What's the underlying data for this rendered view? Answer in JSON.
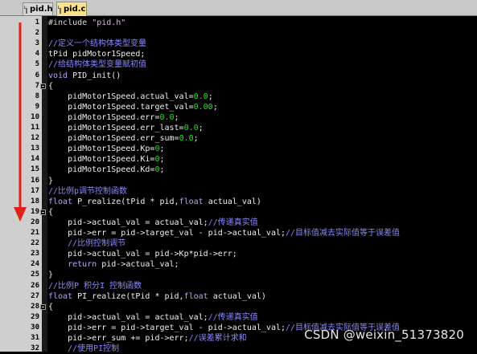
{
  "tabs": [
    {
      "label": "pid.h",
      "active": false
    },
    {
      "label": "pid.c",
      "active": true
    }
  ],
  "lines": [
    {
      "n": "1",
      "fold": false,
      "segs": [
        [
          "pre",
          "#include "
        ],
        [
          "str",
          "\"pid.h\""
        ]
      ]
    },
    {
      "n": "2",
      "fold": false,
      "segs": []
    },
    {
      "n": "3",
      "fold": false,
      "segs": [
        [
          "cmt",
          "//定义一个结构体类型变量"
        ]
      ]
    },
    {
      "n": "4",
      "fold": false,
      "segs": [
        [
          "id",
          "tPid pidMotor1Speed;"
        ]
      ]
    },
    {
      "n": "5",
      "fold": false,
      "segs": [
        [
          "cmt",
          "//给结构体类型变量赋初值"
        ]
      ]
    },
    {
      "n": "6",
      "fold": false,
      "segs": [
        [
          "kw",
          "void "
        ],
        [
          "id",
          "PID_init()"
        ]
      ]
    },
    {
      "n": "7",
      "fold": true,
      "segs": [
        [
          "op",
          "{"
        ]
      ]
    },
    {
      "n": "8",
      "fold": false,
      "segs": [
        [
          "id",
          "    pidMotor1Speed.actual_val="
        ],
        [
          "num",
          "0.0"
        ],
        [
          "op",
          ";"
        ]
      ]
    },
    {
      "n": "9",
      "fold": false,
      "segs": [
        [
          "id",
          "    pidMotor1Speed.target_val="
        ],
        [
          "num",
          "0.00"
        ],
        [
          "op",
          ";"
        ]
      ]
    },
    {
      "n": "10",
      "fold": false,
      "segs": [
        [
          "id",
          "    pidMotor1Speed.err="
        ],
        [
          "num",
          "0.0"
        ],
        [
          "op",
          ";"
        ]
      ]
    },
    {
      "n": "11",
      "fold": false,
      "segs": [
        [
          "id",
          "    pidMotor1Speed.err_last="
        ],
        [
          "num",
          "0.0"
        ],
        [
          "op",
          ";"
        ]
      ]
    },
    {
      "n": "12",
      "fold": false,
      "segs": [
        [
          "id",
          "    pidMotor1Speed.err_sum="
        ],
        [
          "num",
          "0.0"
        ],
        [
          "op",
          ";"
        ]
      ]
    },
    {
      "n": "13",
      "fold": false,
      "segs": [
        [
          "id",
          "    pidMotor1Speed.Kp="
        ],
        [
          "num",
          "0"
        ],
        [
          "op",
          ";"
        ]
      ]
    },
    {
      "n": "14",
      "fold": false,
      "segs": [
        [
          "id",
          "    pidMotor1Speed.Ki="
        ],
        [
          "num",
          "0"
        ],
        [
          "op",
          ";"
        ]
      ]
    },
    {
      "n": "15",
      "fold": false,
      "segs": [
        [
          "id",
          "    pidMotor1Speed.Kd="
        ],
        [
          "num",
          "0"
        ],
        [
          "op",
          ";"
        ]
      ]
    },
    {
      "n": "16",
      "fold": false,
      "segs": [
        [
          "op",
          "}"
        ]
      ]
    },
    {
      "n": "17",
      "fold": false,
      "segs": [
        [
          "cmt",
          "//比例p调节控制函数"
        ]
      ]
    },
    {
      "n": "18",
      "fold": false,
      "segs": [
        [
          "kw",
          "float "
        ],
        [
          "id",
          "P_realize(tPid * pid,"
        ],
        [
          "kw",
          "float "
        ],
        [
          "id",
          "actual_val)"
        ]
      ]
    },
    {
      "n": "19",
      "fold": true,
      "segs": [
        [
          "op",
          "{"
        ]
      ]
    },
    {
      "n": "20",
      "fold": false,
      "segs": [
        [
          "id",
          "    pid->actual_val = actual_val;"
        ],
        [
          "cmt",
          "//传递真实值"
        ]
      ]
    },
    {
      "n": "21",
      "fold": false,
      "segs": [
        [
          "id",
          "    pid->err = pid->target_val - pid->actual_val;"
        ],
        [
          "cmt",
          "//目标值减去实际值等于误差值"
        ]
      ]
    },
    {
      "n": "22",
      "fold": false,
      "segs": [
        [
          "cmt",
          "    //比例控制调节"
        ]
      ]
    },
    {
      "n": "23",
      "fold": false,
      "segs": [
        [
          "id",
          "    pid->actual_val = pid->Kp*pid->err;"
        ]
      ]
    },
    {
      "n": "24",
      "fold": false,
      "segs": [
        [
          "kw",
          "    return "
        ],
        [
          "id",
          "pid->actual_val;"
        ]
      ]
    },
    {
      "n": "25",
      "fold": false,
      "segs": [
        [
          "op",
          "}"
        ]
      ]
    },
    {
      "n": "26",
      "fold": false,
      "segs": [
        [
          "cmt",
          "//比例P 积分I 控制函数"
        ]
      ]
    },
    {
      "n": "27",
      "fold": false,
      "segs": [
        [
          "kw",
          "float "
        ],
        [
          "id",
          "PI_realize(tPid * pid,"
        ],
        [
          "kw",
          "float "
        ],
        [
          "id",
          "actual_val)"
        ]
      ]
    },
    {
      "n": "28",
      "fold": true,
      "segs": [
        [
          "op",
          "{"
        ]
      ]
    },
    {
      "n": "29",
      "fold": false,
      "segs": [
        [
          "id",
          "    pid->actual_val = actual_val;"
        ],
        [
          "cmt",
          "//传递真实值"
        ]
      ]
    },
    {
      "n": "30",
      "fold": false,
      "segs": [
        [
          "id",
          "    pid->err = pid->target_val - pid->actual_val;"
        ],
        [
          "cmt",
          "//目标值减去实际值等于误差值"
        ]
      ]
    },
    {
      "n": "31",
      "fold": false,
      "segs": [
        [
          "id",
          "    pid->err_sum += pid->err;"
        ],
        [
          "cmt",
          "//误差累计求和"
        ]
      ]
    },
    {
      "n": "32",
      "fold": false,
      "segs": [
        [
          "cmt",
          "    //使用PI控制"
        ]
      ]
    }
  ],
  "watermark": "CSDN @weixin_51373820",
  "colors": {
    "arrow": "#e0201a",
    "active_tab": "#fbe28a"
  }
}
